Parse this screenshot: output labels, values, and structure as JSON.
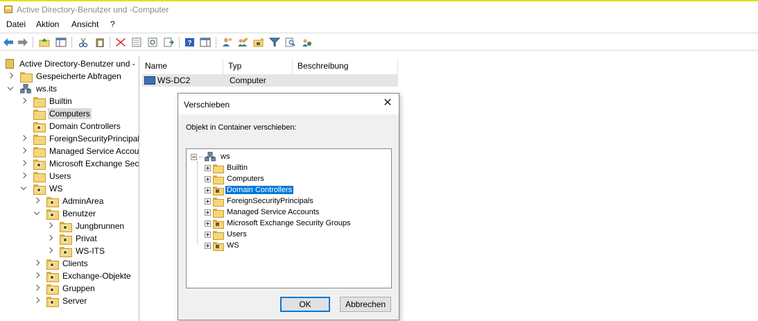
{
  "window": {
    "title": "Active Directory-Benutzer und -Computer"
  },
  "menu": {
    "items": [
      "Datei",
      "Aktion",
      "Ansicht",
      "?"
    ]
  },
  "toolbar": {
    "icons": [
      "back-arrow-icon",
      "forward-arrow-icon",
      "up-folder-icon",
      "show-console-tree-icon",
      "cut-icon",
      "paste-icon",
      "delete-icon",
      "properties-icon",
      "refresh-icon",
      "export-list-icon",
      "help-icon",
      "show-hide-action-pane-icon",
      "new-user-icon",
      "new-group-icon",
      "new-ou-icon",
      "filter-icon",
      "find-icon",
      "add-to-group-icon"
    ]
  },
  "tree": {
    "root": "Active Directory-Benutzer und -",
    "items": [
      {
        "label": "Gespeicherte Abfragen"
      },
      {
        "label": "ws.its"
      },
      {
        "label": "Builtin"
      },
      {
        "label": "Computers"
      },
      {
        "label": "Domain Controllers"
      },
      {
        "label": "ForeignSecurityPrincipals"
      },
      {
        "label": "Managed Service Accounts"
      },
      {
        "label": "Microsoft Exchange Security Groups"
      },
      {
        "label": "Users"
      },
      {
        "label": "WS"
      },
      {
        "label": "AdminArea"
      },
      {
        "label": "Benutzer"
      },
      {
        "label": "Jungbrunnen"
      },
      {
        "label": "Privat"
      },
      {
        "label": "WS-ITS"
      },
      {
        "label": "Clients"
      },
      {
        "label": "Exchange-Objekte"
      },
      {
        "label": "Gruppen"
      },
      {
        "label": "Server"
      }
    ]
  },
  "list": {
    "columns": [
      "Name",
      "Typ",
      "Beschreibung"
    ],
    "rows": [
      {
        "name": "WS-DC2",
        "type": "Computer",
        "description": ""
      }
    ]
  },
  "dialog": {
    "title": "Verschieben",
    "prompt": "Objekt in Container verschieben:",
    "root": "ws",
    "items": [
      "Builtin",
      "Computers",
      "Domain Controllers",
      "ForeignSecurityPrincipals",
      "Managed Service Accounts",
      "Microsoft Exchange Security Groups",
      "Users",
      "WS"
    ],
    "selected": "Domain Controllers",
    "ok_label": "OK",
    "cancel_label": "Abbrechen"
  },
  "colors": {
    "selection": "#0078d7",
    "tree_selection": "#d9d9d9",
    "list_row": "#e5e5e5",
    "title_accent": "#e8e000"
  }
}
